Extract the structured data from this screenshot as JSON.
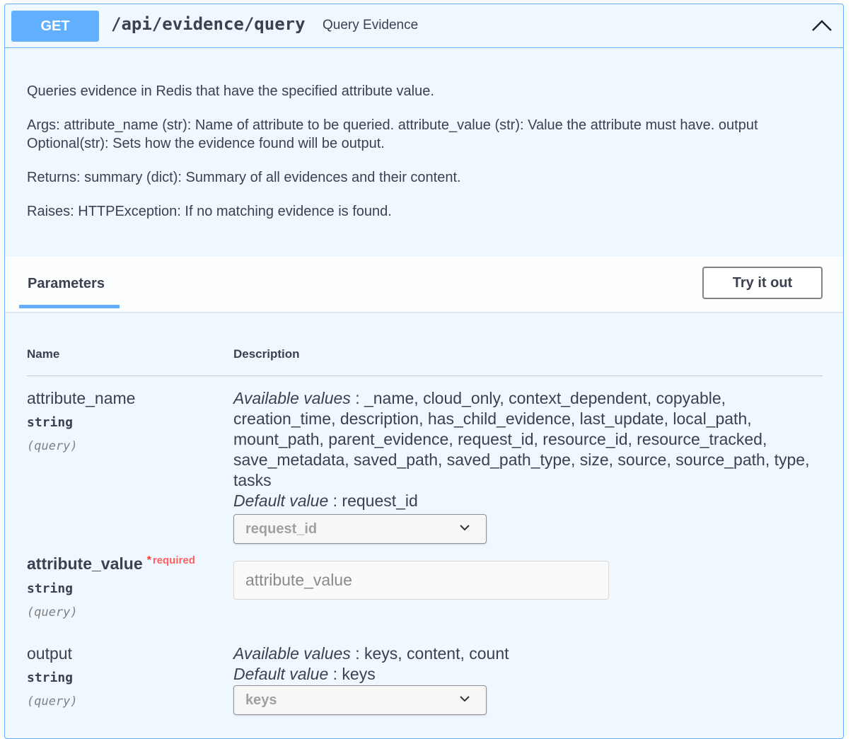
{
  "summary": {
    "method": "GET",
    "path": "/api/evidence/query",
    "description": "Query Evidence",
    "collapse_icon": "chevron-up-icon"
  },
  "description": {
    "paragraphs": [
      "Queries evidence in Redis that have the specified attribute value.",
      "Args: attribute_name (str): Name of attribute to be queried. attribute_value (str): Value the attribute must have. output Optional(str): Sets how the evidence found will be output.",
      "Returns: summary (dict): Summary of all evidences and their content.",
      "Raises: HTTPException: If no matching evidence is found."
    ]
  },
  "parameters": {
    "tab_label": "Parameters",
    "try_it_out_label": "Try it out",
    "columns": {
      "name": "Name",
      "description": "Description"
    },
    "items": [
      {
        "name": "attribute_name",
        "type": "string",
        "in": "(query)",
        "available_label": "Available values",
        "available_values": ": _name, cloud_only, context_dependent, copyable, creation_time, description, has_child_evidence, last_update, local_path, mount_path, parent_evidence, request_id, resource_id, resource_tracked, save_metadata, saved_path, saved_path_type, size, source, source_path, type, tasks",
        "default_label": "Default value",
        "default_value": ": request_id",
        "selected": "request_id"
      },
      {
        "name": "attribute_value",
        "required_star": "*",
        "required_label": "required",
        "type": "string",
        "in": "(query)",
        "placeholder": "attribute_value"
      },
      {
        "name": "output",
        "type": "string",
        "in": "(query)",
        "available_label": "Available values",
        "available_values": ": keys, content, count",
        "default_label": "Default value",
        "default_value": ": keys",
        "selected": "keys"
      }
    ]
  },
  "colors": {
    "get_blue": "#61affe",
    "block_background": "#eff7ff",
    "text": "#3b4151",
    "required_red": "#ff3b30"
  }
}
